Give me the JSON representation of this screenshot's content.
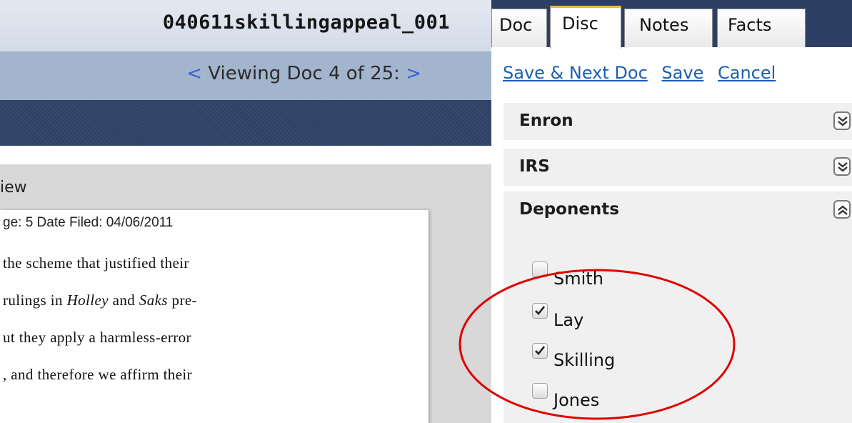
{
  "document": {
    "title": "040611skillingappeal_001",
    "nav": {
      "prev_arrow": "<",
      "text": "Viewing Doc 4 of 25:",
      "next_arrow": ">"
    },
    "view_label": "iew",
    "page_meta": "ge: 5   Date Filed: 04/06/2011",
    "lines": [
      "the scheme that justified their",
      "rulings in Holley and Saks pre-",
      "ut they apply a harmless-error",
      ", and therefore we affirm their"
    ]
  },
  "panel": {
    "tabs": [
      "Doc",
      "Disc",
      "Notes",
      "Facts"
    ],
    "active_tab": "Disc",
    "actions": {
      "save_next": "Save & Next Doc",
      "save": "Save",
      "cancel": "Cancel"
    },
    "sections": [
      {
        "label": "Enron",
        "state": "collapsed",
        "icon": "chevron-double-down-icon"
      },
      {
        "label": "IRS",
        "state": "collapsed",
        "icon": "chevron-double-down-icon"
      },
      {
        "label": "Deponents",
        "state": "expanded",
        "icon": "chevron-double-up-icon"
      }
    ],
    "deponents": [
      {
        "name": "Smith",
        "checked": false
      },
      {
        "name": "Lay",
        "checked": true
      },
      {
        "name": "Skilling",
        "checked": true
      },
      {
        "name": "Jones",
        "checked": false
      }
    ]
  },
  "colors": {
    "header_dark": "#2d4064",
    "nav_bar": "#a3b5cd",
    "link": "#1a5fb4",
    "active_tab_accent": "#f2b731",
    "annotation": "#e00000"
  }
}
